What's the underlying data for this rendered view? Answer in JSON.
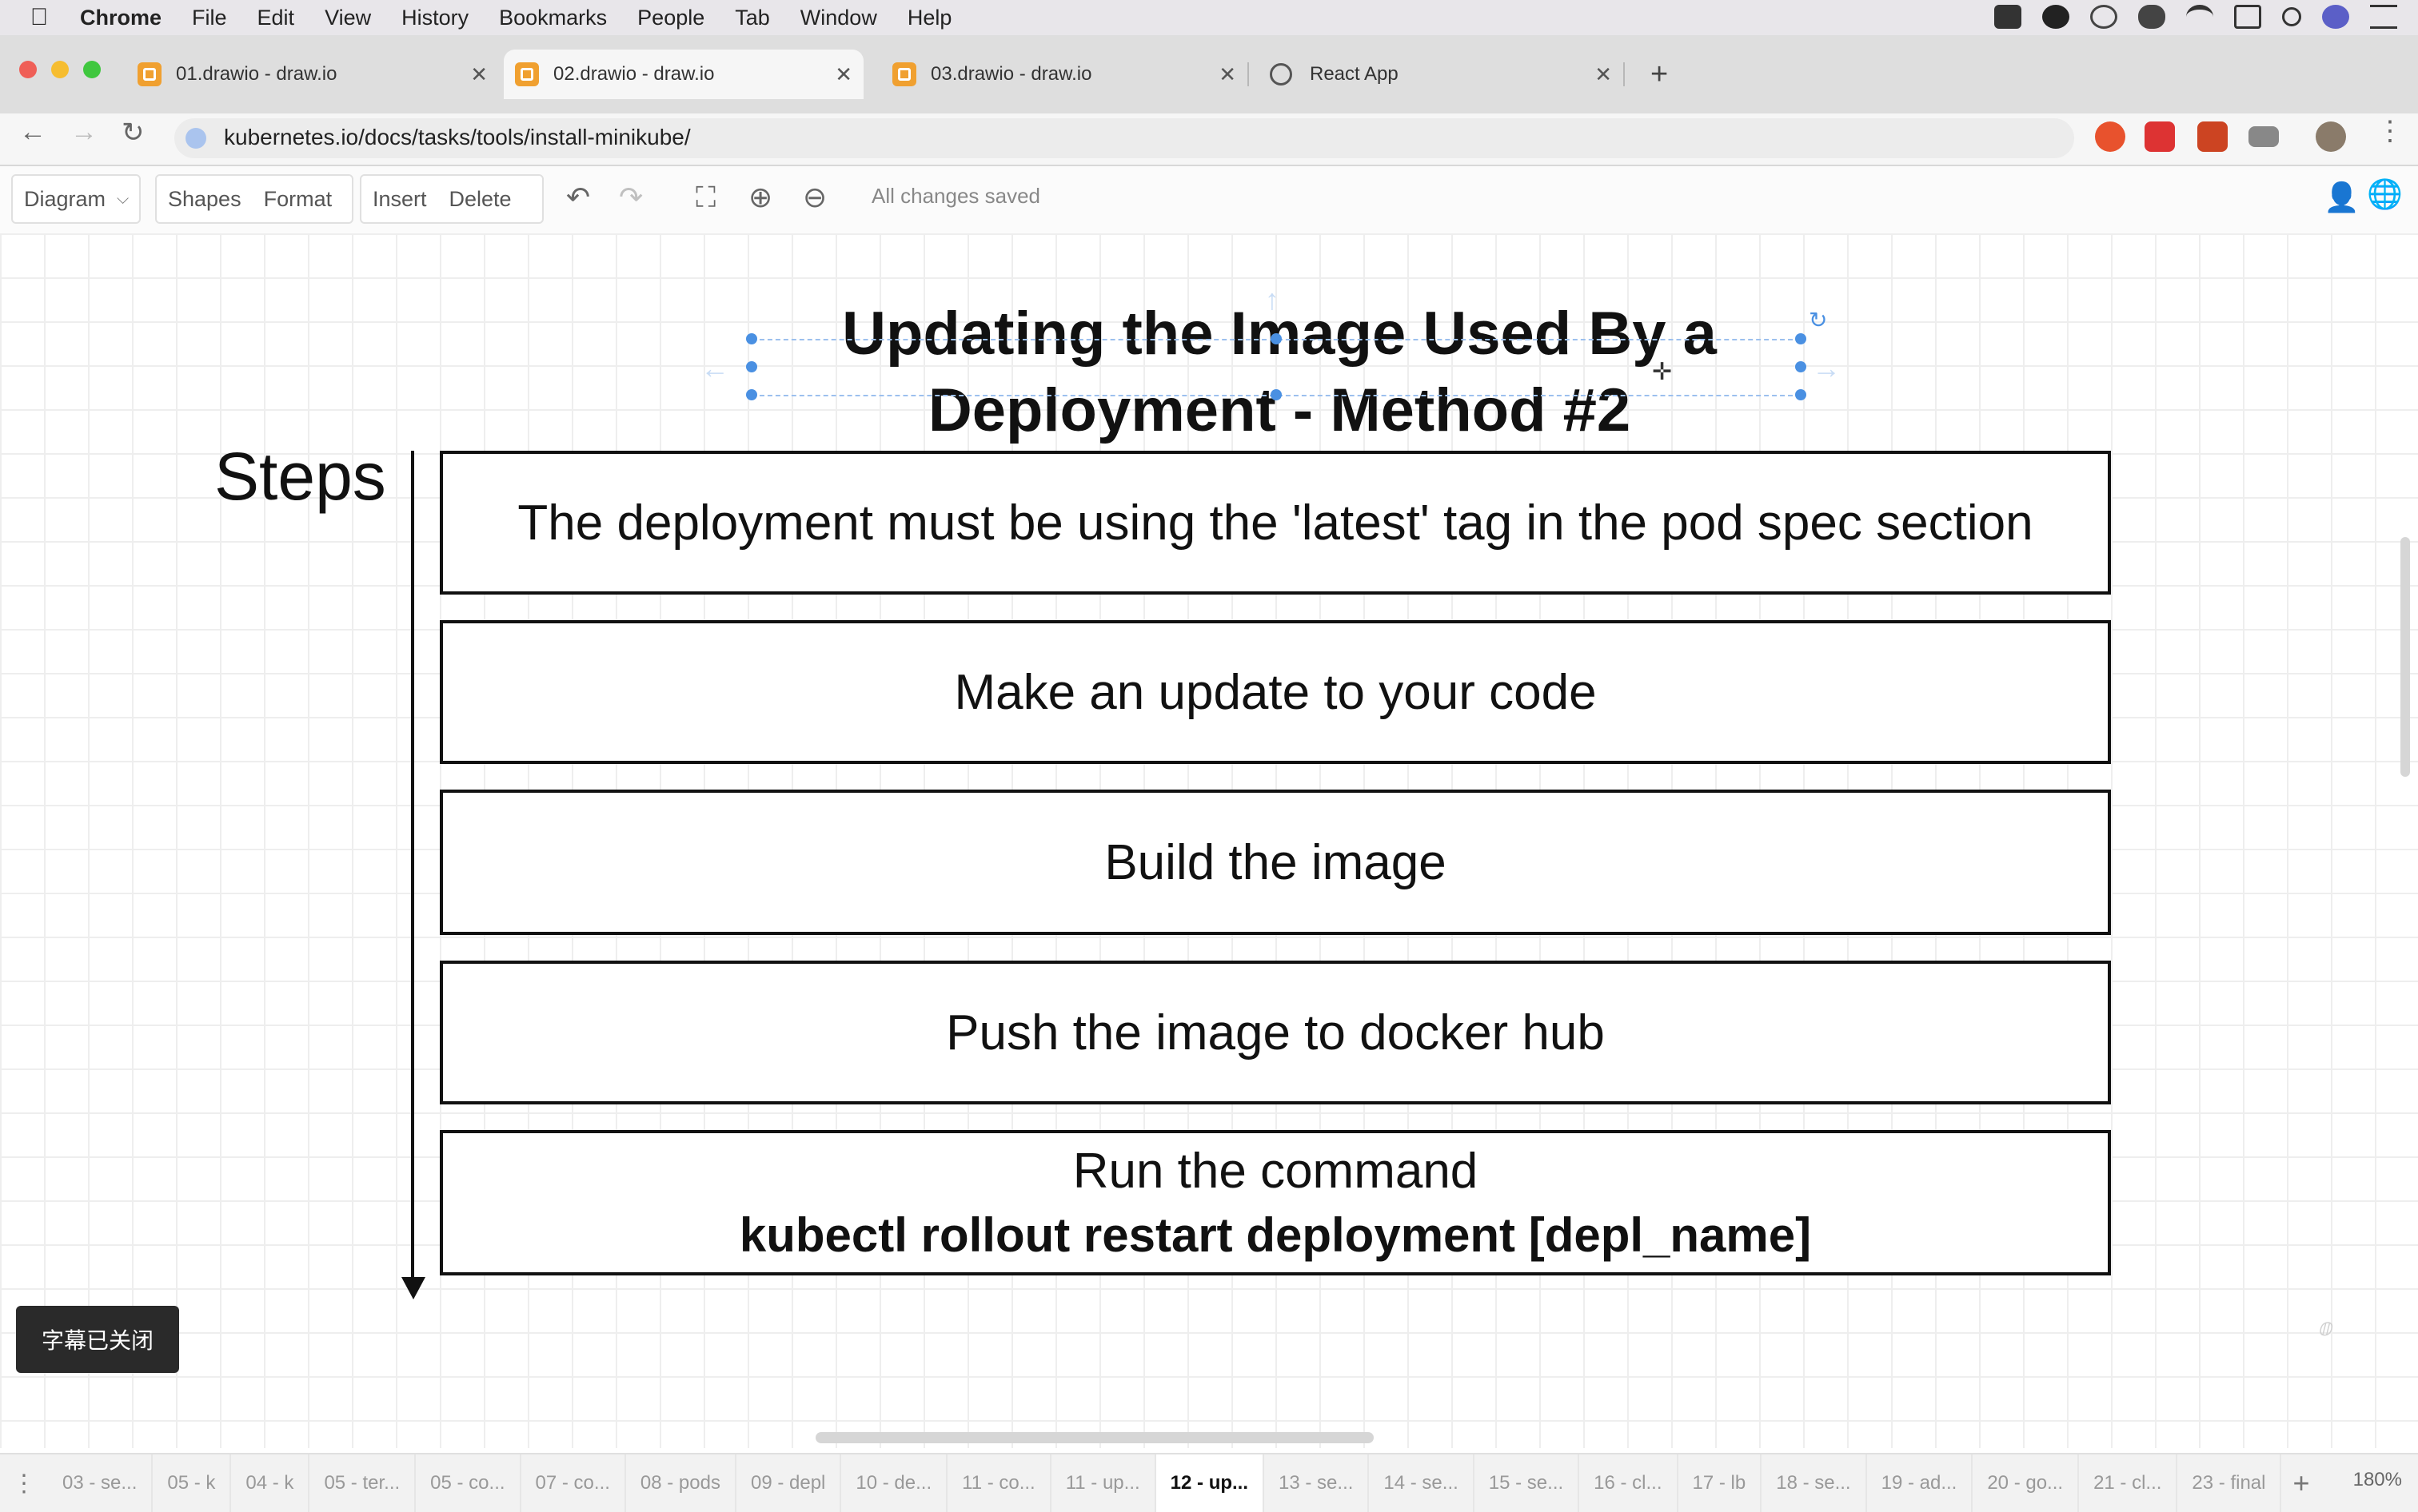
{
  "menubar": {
    "app": "Chrome",
    "items": [
      "File",
      "Edit",
      "View",
      "History",
      "Bookmarks",
      "People",
      "Tab",
      "Window",
      "Help"
    ]
  },
  "tabs": [
    {
      "title": "01.drawio - draw.io",
      "active": false
    },
    {
      "title": "02.drawio - draw.io",
      "active": true
    },
    {
      "title": "03.drawio - draw.io",
      "active": false
    },
    {
      "title": "React App",
      "active": false
    }
  ],
  "address": {
    "url": "kubernetes.io/docs/tasks/tools/install-minikube/"
  },
  "toolbar": {
    "diagram": "Diagram",
    "shapes": "Shapes",
    "format": "Format",
    "insert": "Insert",
    "delete": "Delete",
    "status": "All changes saved"
  },
  "diagram": {
    "title_line1": "Updating the Image Used By a",
    "title_line2": "Deployment - Method #2",
    "steps_label": "Steps",
    "steps": [
      "The deployment must be using the 'latest' tag in the pod spec section",
      "Make an update to your code",
      "Build the image",
      "Push the image to docker hub",
      "Run the command"
    ],
    "command": "kubectl rollout restart deployment [depl_name]"
  },
  "overlay": {
    "subtitles": "字幕已关闭"
  },
  "pages": {
    "tabs": [
      "03 - se...",
      "05 - k",
      "04 - k",
      "05 - ter...",
      "05 - co...",
      "07 - co...",
      "08 - pods",
      "09 - depl",
      "10 - de...",
      "11 - co...",
      "11 - up...",
      "12 - up...",
      "13 - se...",
      "14 - se...",
      "15 - se...",
      "16 - cl...",
      "17 - lb",
      "18 - se...",
      "19 - ad...",
      "20 - go...",
      "21 - cl...",
      "23 - final"
    ],
    "active_index": 11,
    "zoom": "180%"
  }
}
